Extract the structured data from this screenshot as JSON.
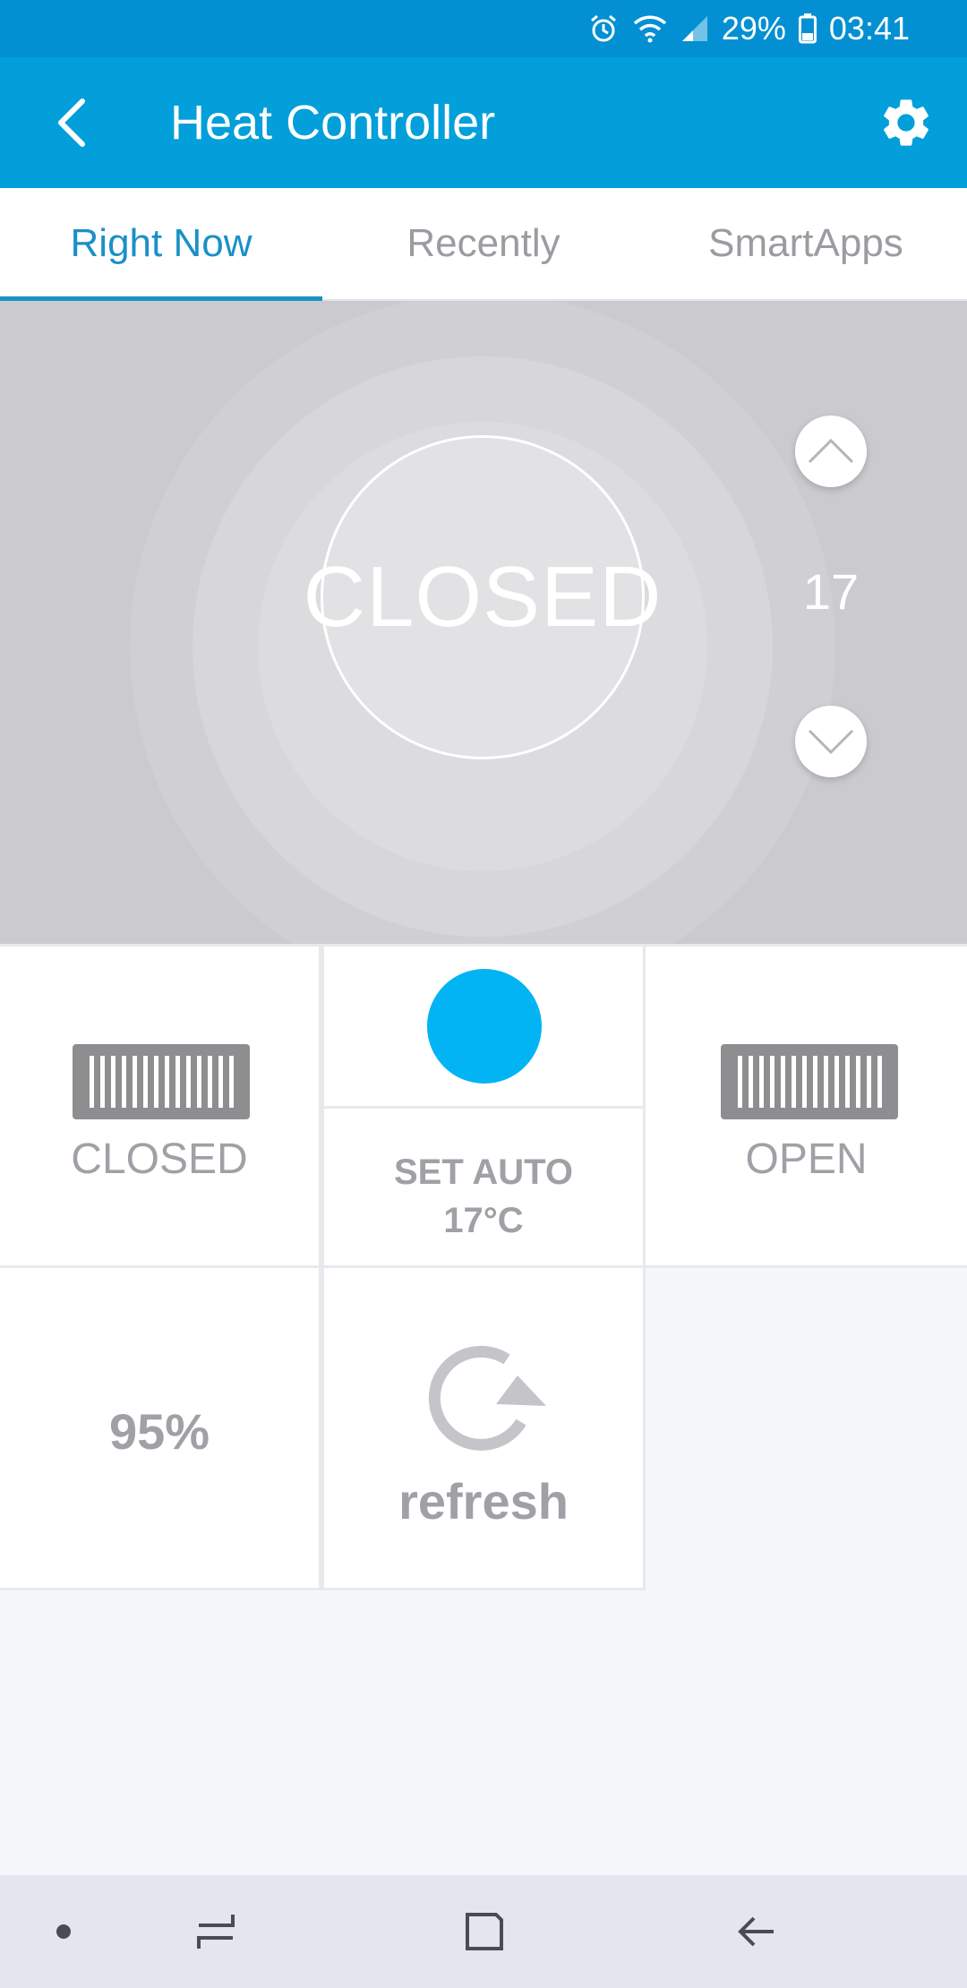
{
  "status_bar": {
    "battery": "29%",
    "time": "03:41",
    "icons": [
      "alarm-icon",
      "wifi-icon",
      "signal-icon",
      "battery-icon"
    ]
  },
  "app_bar": {
    "title": "Heat Controller",
    "back_icon": "chevron-left-icon",
    "settings_icon": "gear-icon"
  },
  "tabs": [
    {
      "label": "Right Now",
      "active": true
    },
    {
      "label": "Recently",
      "active": false
    },
    {
      "label": "SmartApps",
      "active": false
    }
  ],
  "thermostat": {
    "status": "CLOSED",
    "setpoint": "17"
  },
  "tiles": {
    "closed_label": "CLOSED",
    "mode_line1": "SET AUTO",
    "mode_line2": "17°C",
    "open_label": "OPEN",
    "percentage": "95%",
    "refresh_label": "refresh"
  },
  "colors": {
    "status_bar": "#0290d2",
    "app_bar": "#029fda",
    "accent": "#1a90c8",
    "indicator": "#02b4f4",
    "hero_bg": "#cbcbcf"
  }
}
